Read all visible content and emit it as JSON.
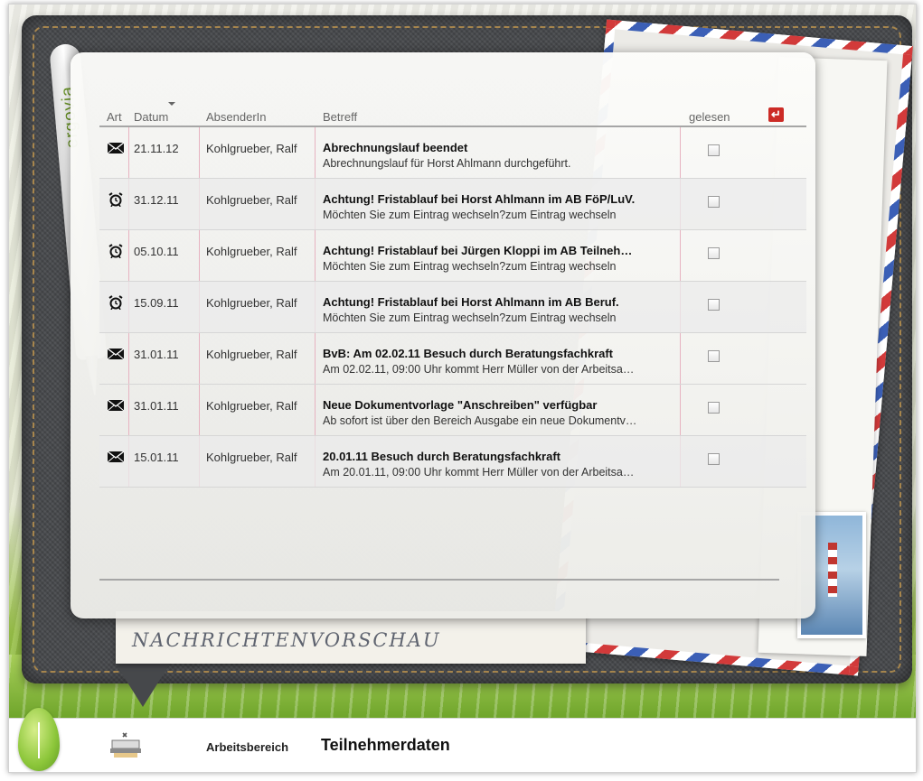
{
  "pen_brand": "ergovia",
  "table": {
    "headers": {
      "type": "Art",
      "date": "Datum",
      "sender": "AbsenderIn",
      "subject": "Betreff",
      "read": "gelesen"
    },
    "sort_column": "Datum",
    "rows": [
      {
        "type_icon": "envelope-icon",
        "date": "21.11.12",
        "sender": "Kohlgrueber, Ralf",
        "subject": "Abrechnungslauf beendet",
        "preview": "Abrechnungslauf für Horst Ahlmann durchgeführt.",
        "read": false
      },
      {
        "type_icon": "alarm-clock-icon",
        "date": "31.12.11",
        "sender": "Kohlgrueber, Ralf",
        "subject": "Achtung! Fristablauf bei Horst Ahlmann im AB FöP/LuV.",
        "preview": "Möchten Sie zum Eintrag wechseln?zum Eintrag wechseln",
        "read": false
      },
      {
        "type_icon": "alarm-clock-icon",
        "date": "05.10.11",
        "sender": "Kohlgrueber, Ralf",
        "subject": "Achtung! Fristablauf bei Jürgen Kloppi im AB Teilneh…",
        "preview": "Möchten Sie zum Eintrag wechseln?zum Eintrag wechseln",
        "read": false
      },
      {
        "type_icon": "alarm-clock-icon",
        "date": "15.09.11",
        "sender": "Kohlgrueber, Ralf",
        "subject": "Achtung! Fristablauf bei Horst Ahlmann im AB Beruf.",
        "preview": "Möchten Sie zum Eintrag wechseln?zum Eintrag wechseln",
        "read": false
      },
      {
        "type_icon": "envelope-icon",
        "date": "31.01.11",
        "sender": "Kohlgrueber, Ralf",
        "subject": "BvB: Am 02.02.11 Besuch durch Beratungsfachkraft",
        "preview": "Am 02.02.11, 09:00 Uhr kommt Herr Müller von der Arbeitsa…",
        "read": false
      },
      {
        "type_icon": "envelope-icon",
        "date": "31.01.11",
        "sender": "Kohlgrueber, Ralf",
        "subject": "Neue Dokumentvorlage \"Anschreiben\" verfügbar",
        "preview": "Ab sofort ist über den Bereich Ausgabe ein neue Dokumentv…",
        "read": false
      },
      {
        "type_icon": "envelope-icon",
        "date": "15.01.11",
        "sender": "Kohlgrueber, Ralf",
        "subject": "20.01.11 Besuch durch Beratungsfachkraft",
        "preview": "Am 20.01.11, 09:00 Uhr kommt Herr Müller von der Arbeitsa…",
        "read": false
      }
    ]
  },
  "card_label": "NACHRICHTENVORSCHAU",
  "footer": {
    "link": "Arbeitsbereich",
    "title": "Teilnehmerdaten"
  },
  "colors": {
    "exit_button": "#cc2b26",
    "stitch": "#c79a4e",
    "denim": "#46484b",
    "leaf": "#8cc63a"
  }
}
